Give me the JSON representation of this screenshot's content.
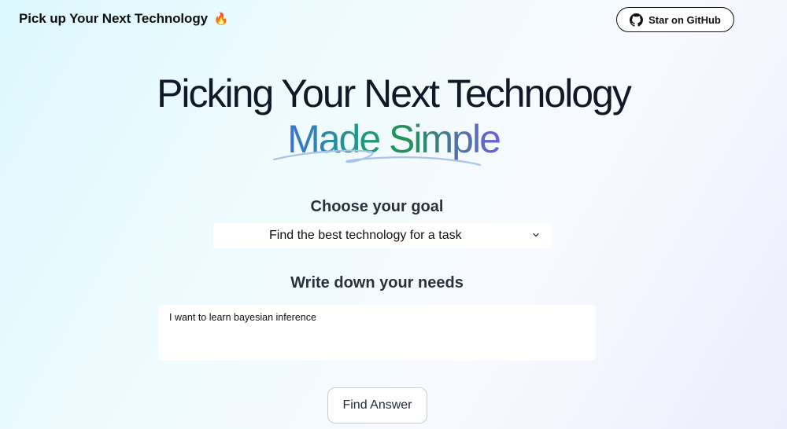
{
  "header": {
    "title": "Pick up Your Next Technology",
    "title_emoji": "🔥",
    "github_button_label": "Star on GitHub"
  },
  "hero": {
    "line1": "Picking Your Next Technology",
    "line2": "Made Simple"
  },
  "goal": {
    "heading": "Choose your goal",
    "selected": "Find the best technology for a task"
  },
  "needs": {
    "heading": "Write down your needs",
    "value": "I want to learn bayesian inference"
  },
  "actions": {
    "find_label": "Find Answer"
  },
  "icons": {
    "github": "github-icon",
    "chevron": "chevron-down-icon",
    "fire": "fire-emoji"
  },
  "colors": {
    "gradient_start": "#3b72d8",
    "gradient_mid": "#249155",
    "gradient_end": "#6a5fe0"
  }
}
